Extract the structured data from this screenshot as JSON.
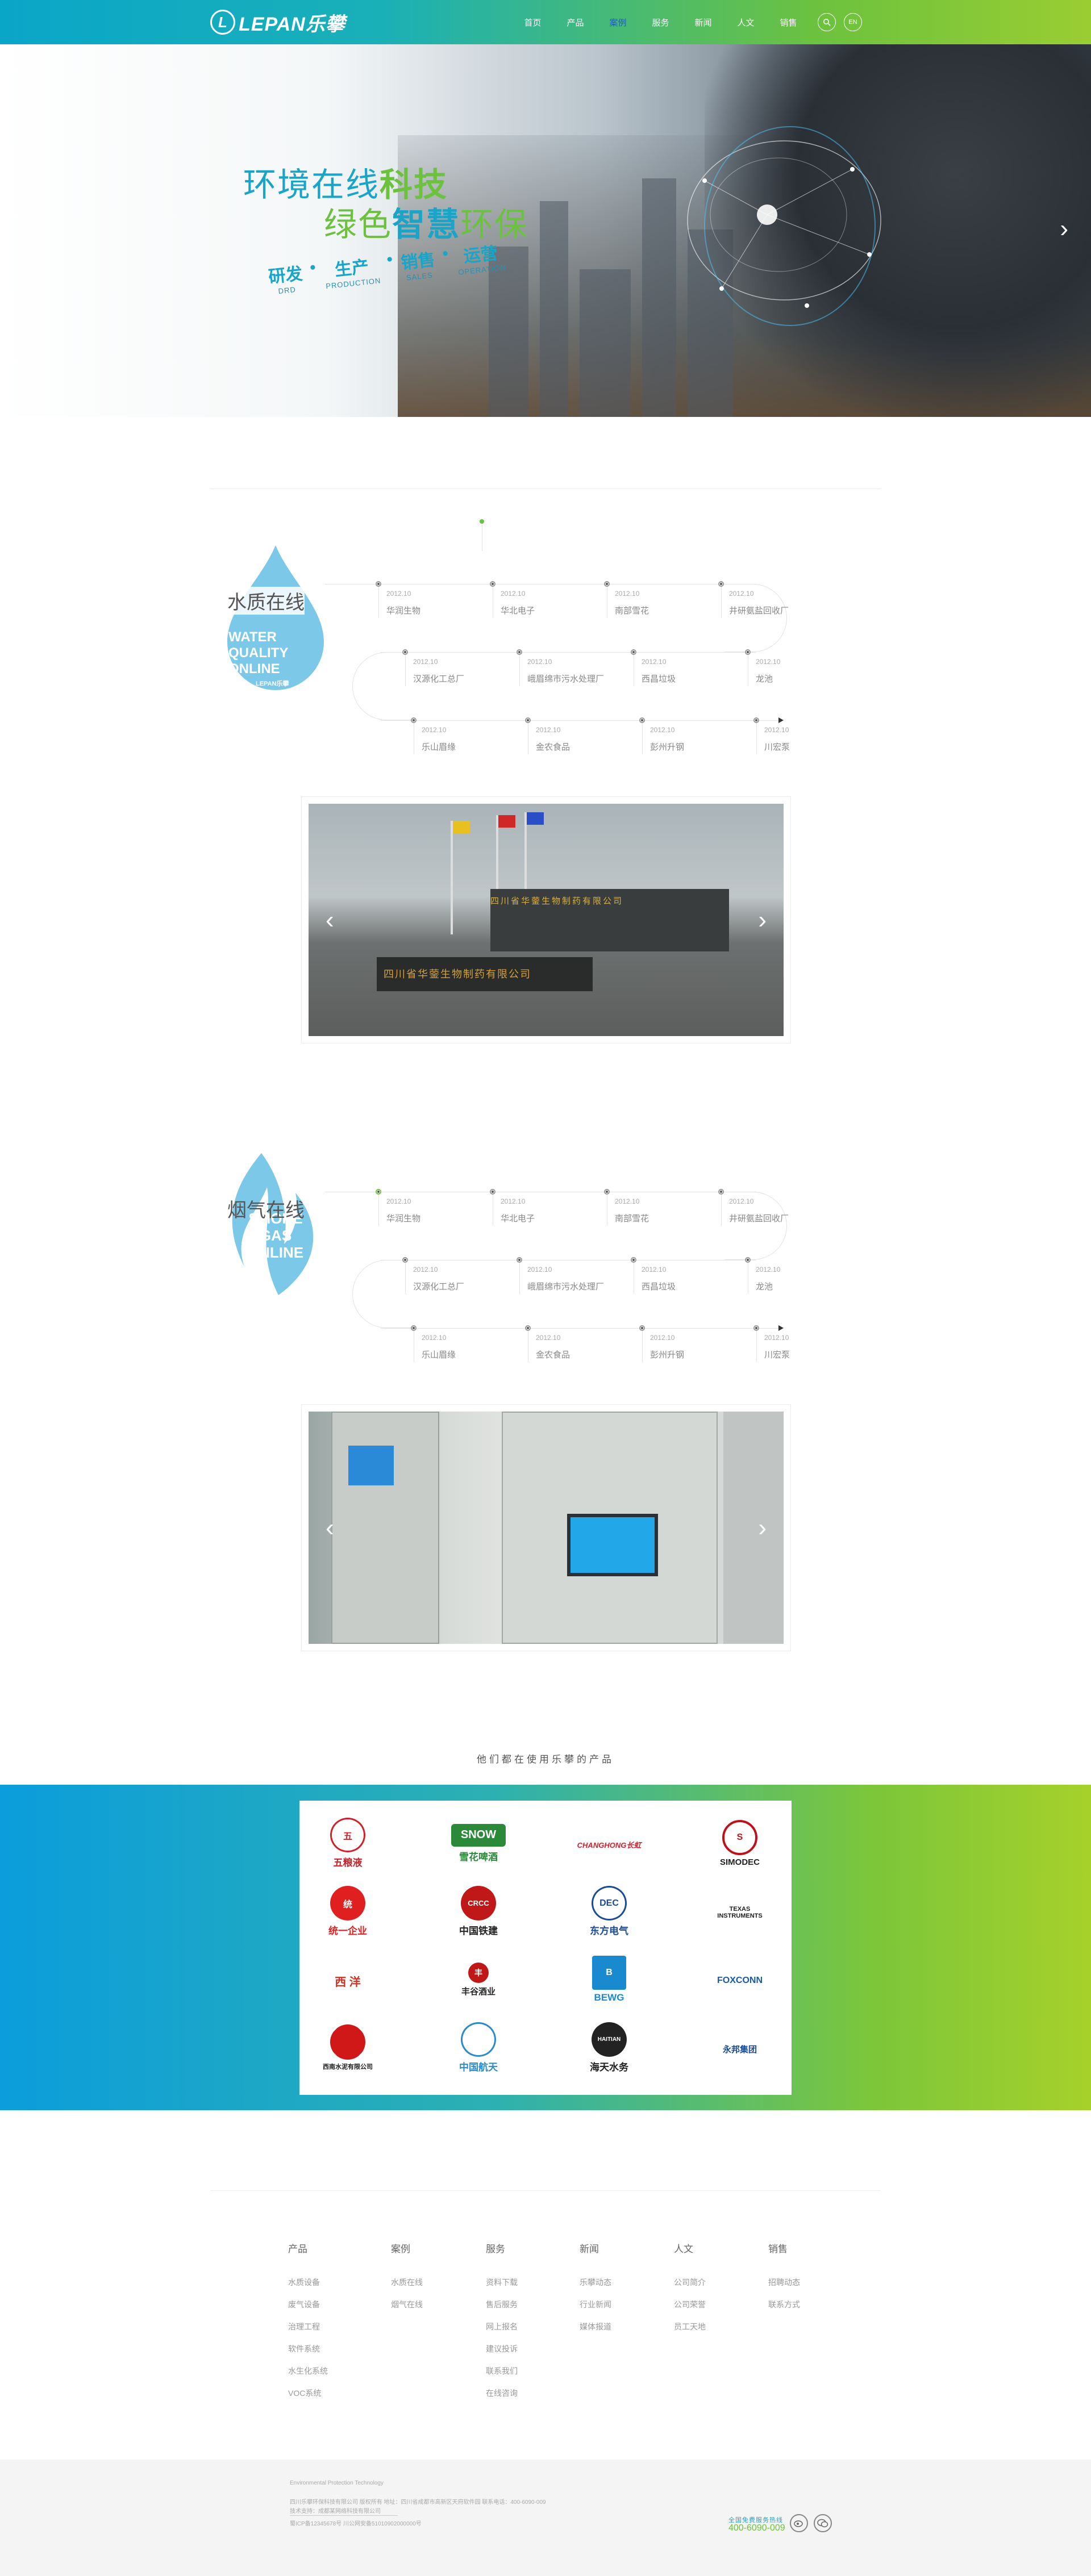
{
  "header": {
    "logo_mark": "L",
    "logo_text": "LEPAN乐攀",
    "nav": [
      "首页",
      "产品",
      "案例",
      "服务",
      "新闻",
      "人文",
      "销售"
    ],
    "active_nav": "案例",
    "search_icon": "search-icon",
    "lang_label": "EN"
  },
  "hero": {
    "line1_a": "环境在线",
    "line1_b": "科技",
    "line2_a": "绿色",
    "line2_b": "智慧",
    "line2_c": "环保",
    "tags": [
      {
        "cn": "研发",
        "en": "DRD"
      },
      {
        "cn": "生产",
        "en": "PRODUCTION"
      },
      {
        "cn": "销售",
        "en": "SALES"
      },
      {
        "cn": "运营",
        "en": "OPERATION"
      }
    ],
    "tag_separator": "•",
    "next_icon": "›"
  },
  "water": {
    "title": "水质在线",
    "badge_en": [
      "WATER",
      "QUALITY",
      "ONLINE"
    ],
    "badge_brand": "LEPAN乐攀",
    "rows": [
      [
        {
          "date": "2012.10",
          "name": "华润生物"
        },
        {
          "date": "2012.10",
          "name": "华北电子"
        },
        {
          "date": "2012.10",
          "name": "南部雪花"
        },
        {
          "date": "2012.10",
          "name": "井研氨盐回收厂"
        }
      ],
      [
        {
          "date": "2012.10",
          "name": "汉源化工总厂"
        },
        {
          "date": "2012.10",
          "name": "峨眉绵市污水处理厂"
        },
        {
          "date": "2012.10",
          "name": "西昌垃圾"
        },
        {
          "date": "2012.10",
          "name": "龙池"
        }
      ],
      [
        {
          "date": "2012.10",
          "name": "乐山眉缘"
        },
        {
          "date": "2012.10",
          "name": "金农食品"
        },
        {
          "date": "2012.10",
          "name": "彭州升钢"
        },
        {
          "date": "2012.10",
          "name": "川宏泵"
        }
      ]
    ],
    "slider_sign": "四川省华蓥生物制药有限公司",
    "slider_sign2": "四川省华蓥生物制药有限公司"
  },
  "smoke": {
    "title": "烟气在线",
    "badge_en": [
      "SMOKE",
      "GAS",
      "ONLINE"
    ],
    "rows": [
      [
        {
          "date": "2012.10",
          "name": "华润生物"
        },
        {
          "date": "2012.10",
          "name": "华北电子"
        },
        {
          "date": "2012.10",
          "name": "南部雪花"
        },
        {
          "date": "2012.10",
          "name": "井研氨盐回收厂"
        }
      ],
      [
        {
          "date": "2012.10",
          "name": "汉源化工总厂"
        },
        {
          "date": "2012.10",
          "name": "峨眉绵市污水处理厂"
        },
        {
          "date": "2012.10",
          "name": "西昌垃圾"
        },
        {
          "date": "2012.10",
          "name": "龙池"
        }
      ],
      [
        {
          "date": "2012.10",
          "name": "乐山眉缘"
        },
        {
          "date": "2012.10",
          "name": "金农食品"
        },
        {
          "date": "2012.10",
          "name": "彭州升钢"
        },
        {
          "date": "2012.10",
          "name": "川宏泵"
        }
      ]
    ]
  },
  "slider_prev": "‹",
  "slider_next": "›",
  "clients": {
    "title": "他们都在使用乐攀的产品",
    "logos": [
      {
        "name": "五粮液",
        "mark": "五",
        "color": "#d0202a"
      },
      {
        "name": "雪花啤酒",
        "mark": "SNOW",
        "color": "#2a8a3a"
      },
      {
        "name": "CHANGHONG长虹",
        "mark": "",
        "color": "#d0202a"
      },
      {
        "name": "SIMODEC",
        "mark": "S",
        "color": "#c0101a"
      },
      {
        "name": "统一企业",
        "mark": "统",
        "color": "#e02020"
      },
      {
        "name": "中国铁建",
        "mark": "CRCC",
        "color": "#c01818"
      },
      {
        "name": "东方电气",
        "mark": "DEC",
        "color": "#1a4a9a"
      },
      {
        "name": "TEXAS INSTRUMENTS",
        "mark": "",
        "color": "#c81010"
      },
      {
        "name": "西 洋",
        "mark": "",
        "color": "#d03020"
      },
      {
        "name": "丰谷酒业",
        "mark": "丰",
        "color": "#c01818"
      },
      {
        "name": "BEWG",
        "mark": "B",
        "color": "#1a8ad0"
      },
      {
        "name": "FOXCONN",
        "mark": "",
        "color": "#1a5aa8"
      },
      {
        "name": "西南水泥有限公司",
        "mark": "",
        "color": "#d01818"
      },
      {
        "name": "中国航天",
        "mark": "",
        "color": "#2a8acb"
      },
      {
        "name": "海天水务",
        "mark": "HAITIAN",
        "color": "#222222"
      },
      {
        "name": "永邦集团",
        "mark": "",
        "color": "#1a4a9a"
      }
    ]
  },
  "footer_nav": [
    {
      "head": "产品",
      "links": [
        "水质设备",
        "废气设备",
        "治理工程",
        "软件系统",
        "水生化系统",
        "VOC系统"
      ]
    },
    {
      "head": "案例",
      "links": [
        "水质在线",
        "烟气在线"
      ]
    },
    {
      "head": "服务",
      "links": [
        "资料下载",
        "售后服务",
        "网上报名",
        "建议投诉",
        "联系我们",
        "在线咨询"
      ]
    },
    {
      "head": "新闻",
      "links": [
        "乐攀动态",
        "行业新闻",
        "媒体报道"
      ]
    },
    {
      "head": "人文",
      "links": [
        "公司简介",
        "公司荣誉",
        "员工天地"
      ]
    },
    {
      "head": "销售",
      "links": [
        "招聘动态",
        "联系方式"
      ]
    }
  ],
  "footer_bottom": {
    "tagline": "Environmental Protection Technology",
    "line1": "四川乐攀环保科技有限公司 版权所有 地址：四川省成都市高新区天府软件园 联系电话：400-6090-009",
    "line2": "技术支持：成都某网络科技有限公司",
    "line3": "蜀ICP备12345678号 川公网安备51010902000000号",
    "phone_label": "全国免费服务热线",
    "phone": "400-6090-009",
    "weibo_icon": "weibo-icon",
    "wechat_icon": "wechat-icon"
  }
}
